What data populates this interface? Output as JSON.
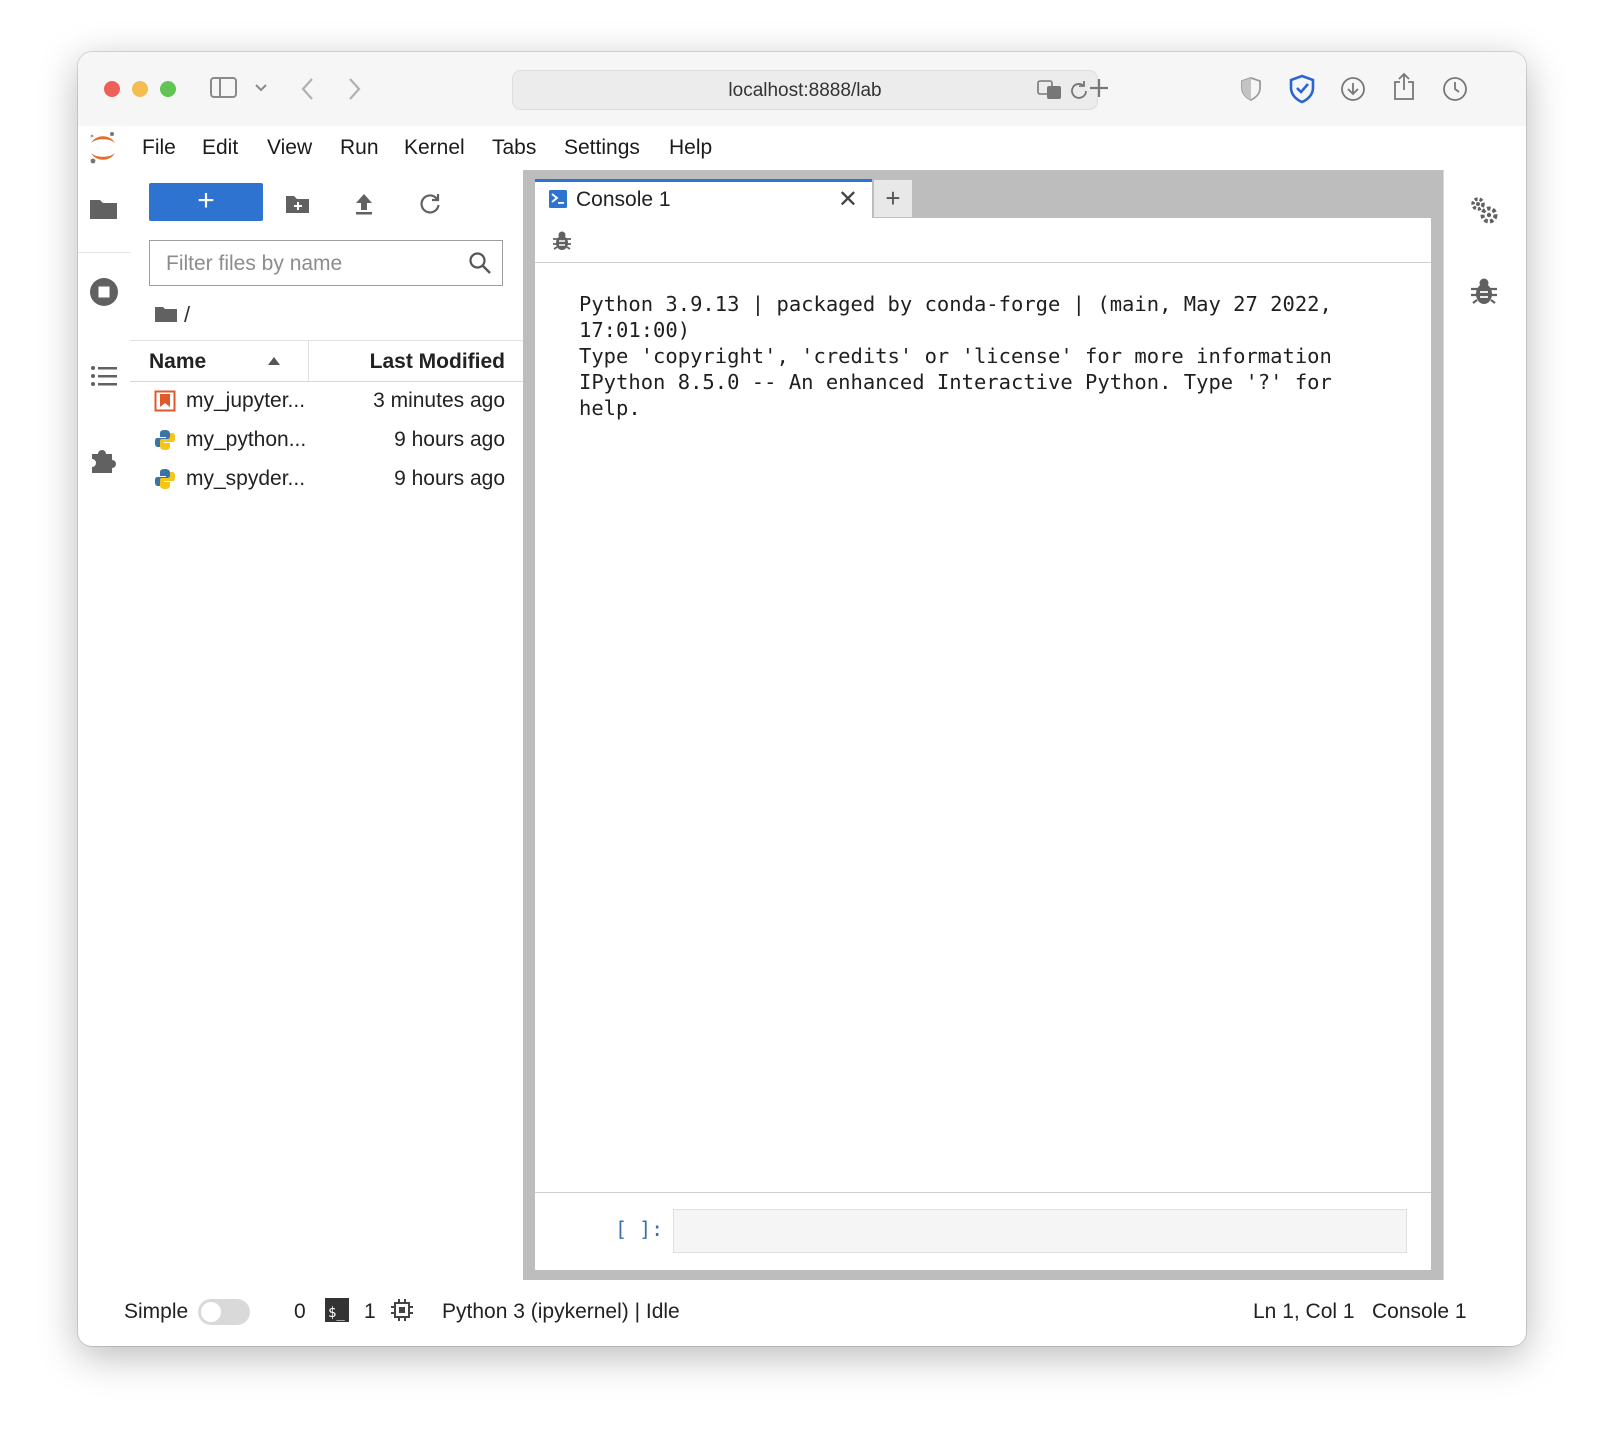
{
  "browser": {
    "url": "localhost:8888/lab",
    "colors": {
      "close": "#ee5f57",
      "minimize": "#f5bd4f",
      "zoom": "#61c454"
    }
  },
  "menu": [
    "File",
    "Edit",
    "View",
    "Run",
    "Kernel",
    "Tabs",
    "Settings",
    "Help"
  ],
  "filebrowser": {
    "new_label": "+",
    "filter_placeholder": "Filter files by name",
    "breadcrumb": "/",
    "col_name": "Name",
    "col_modified": "Last Modified",
    "files": [
      {
        "name": "my_jupyter...",
        "modified": "3 minutes ago",
        "icon": "notebook-icon"
      },
      {
        "name": "my_python...",
        "modified": "9 hours ago",
        "icon": "python-icon"
      },
      {
        "name": "my_spyder...",
        "modified": "9 hours ago",
        "icon": "python-icon"
      }
    ]
  },
  "tab": {
    "label": "Console 1",
    "close": "✕",
    "add": "+"
  },
  "console": {
    "output": "Python 3.9.13 | packaged by conda-forge | (main, May 27 2022,\n17:01:00)\nType 'copyright', 'credits' or 'license' for more information\nIPython 8.5.0 -- An enhanced Interactive Python. Type '?' for\nhelp.",
    "prompt": "[ ]:"
  },
  "status": {
    "mode": "Simple",
    "terminals": "0",
    "kernels": "1",
    "kernel": "Python 3 (ipykernel) | Idle",
    "position": "Ln 1, Col 1",
    "doc": "Console 1"
  },
  "colors": {
    "accent": "#2f73d0",
    "python_blue": "#3a73a8",
    "python_yellow": "#f5c518",
    "notebook_orange": "#e0592a"
  }
}
